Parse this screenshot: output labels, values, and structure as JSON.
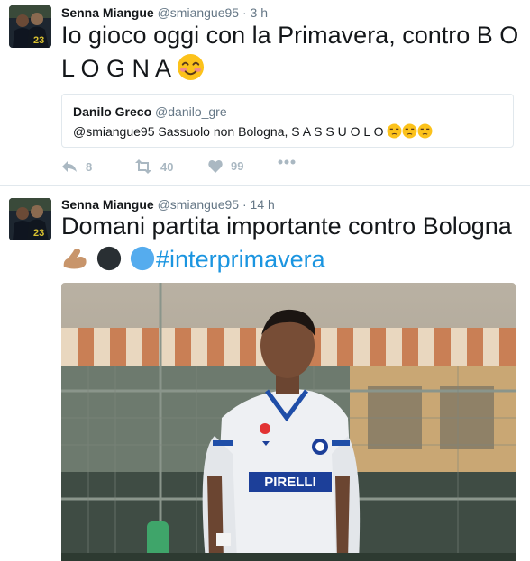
{
  "tweets": [
    {
      "author_name": "Senna Miangue",
      "author_handle": "@smiangue95",
      "separator": "·",
      "time": "3 h",
      "text_line1": "Io gioco oggi con la Primavera, contro B O",
      "text_line2": "L O G N A",
      "emoji": "smiling-face-with-smiling-eyes",
      "quoted": {
        "author_name": "Danilo Greco",
        "author_handle": "@danilo_gre",
        "text": "@smiangue95 Sassuolo non Bologna, S A S S U O L O",
        "emojis": [
          "unamused-face",
          "unamused-face",
          "unamused-face"
        ]
      },
      "actions": {
        "reply_count": "8",
        "retweet_count": "40",
        "like_count": "99"
      }
    },
    {
      "author_name": "Senna Miangue",
      "author_handle": "@smiangue95",
      "separator": "·",
      "time": "14 h",
      "text_line1": "Domani partita importante contro Bologna",
      "emojis": [
        "flexed-biceps",
        "black-circle",
        "blue-circle"
      ],
      "hashtag": "#interprimavera",
      "media": {
        "description_icon": "photo-of-player",
        "shirt_sponsor": "PIRELLI"
      }
    }
  ],
  "colors": {
    "link": "#1b95e0",
    "muted": "#657786",
    "action_gray": "#aab8c2",
    "border": "#e1e8ed"
  }
}
